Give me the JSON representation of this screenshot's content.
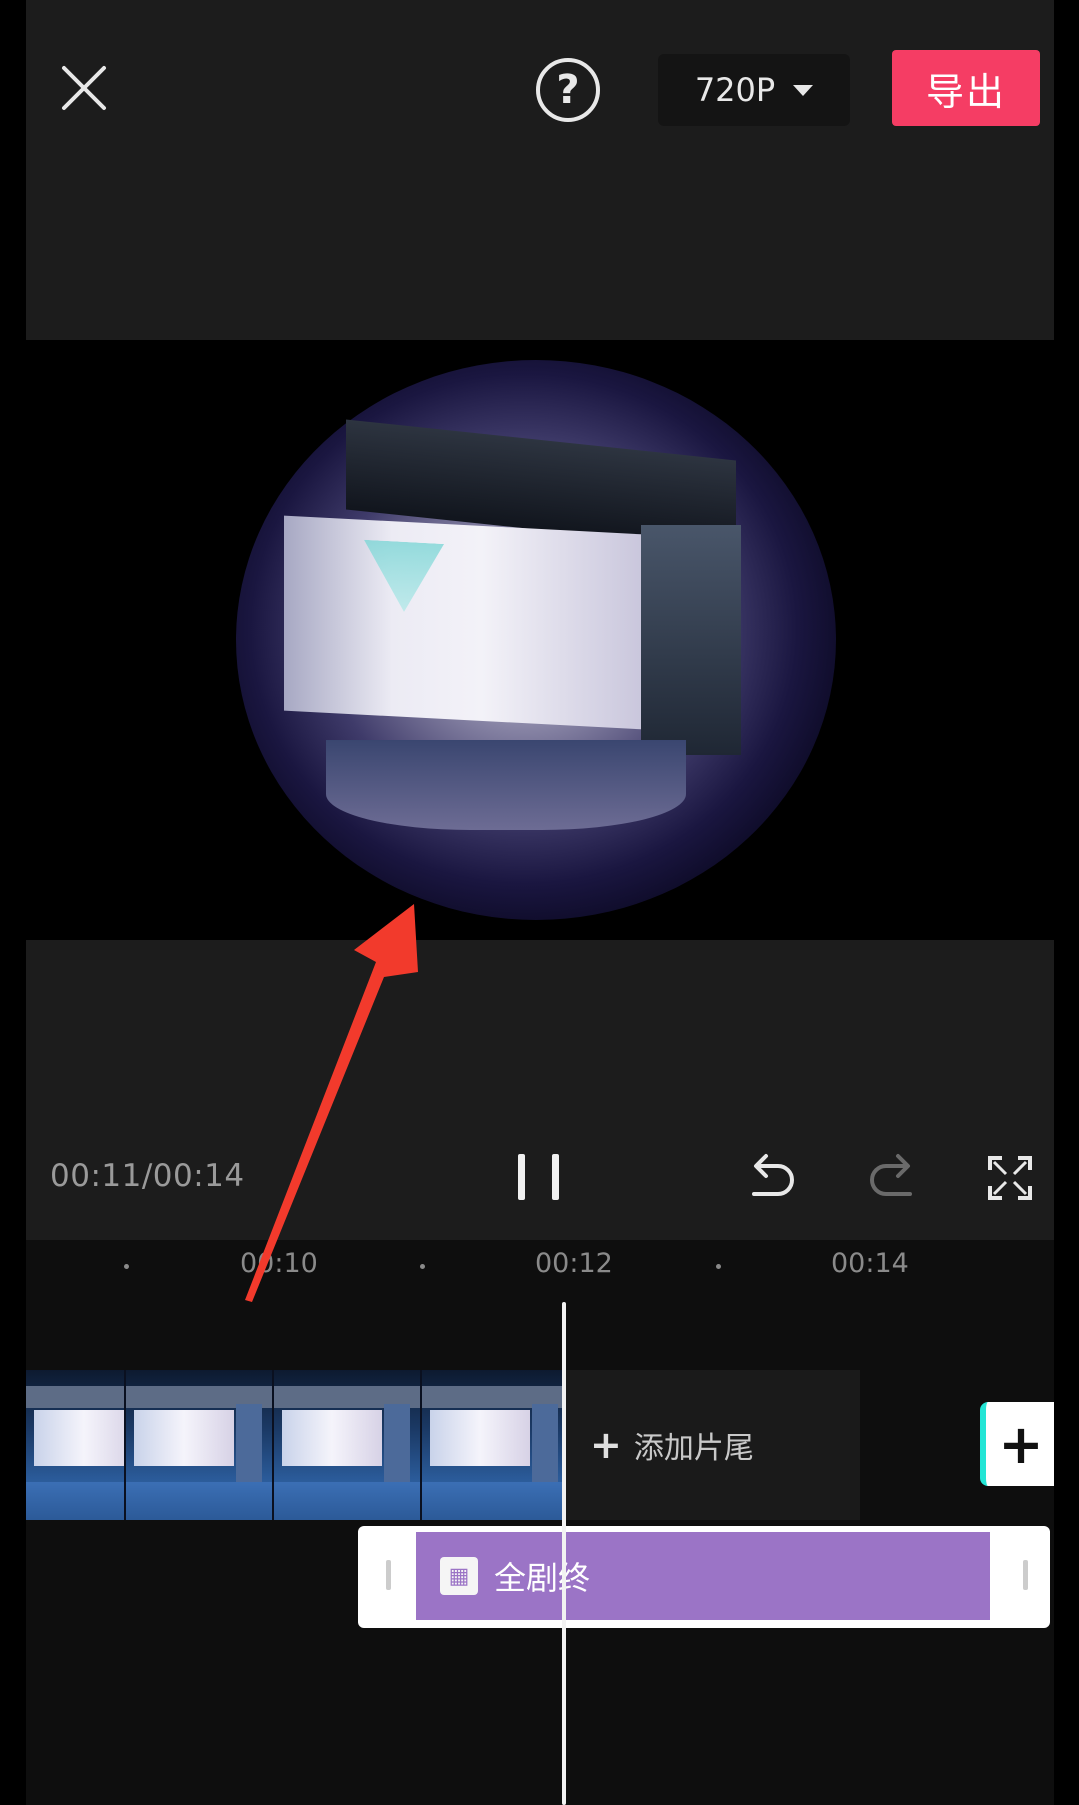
{
  "header": {
    "resolution": "720P",
    "export_label": "导出"
  },
  "player": {
    "time": "00:11/00:14"
  },
  "timeline": {
    "ticks": [
      "00:10",
      "00:12",
      "00:14"
    ],
    "ending_label": "添加片尾",
    "effect_label": "全剧终",
    "effect_color": "#9b74c6"
  },
  "annotation": {
    "arrow_color": "#f23a2c"
  },
  "icons": [
    "close-icon",
    "help-icon",
    "chevron-down-icon",
    "pause-icon",
    "undo-icon",
    "redo-icon",
    "fullscreen-icon",
    "plus-icon"
  ]
}
